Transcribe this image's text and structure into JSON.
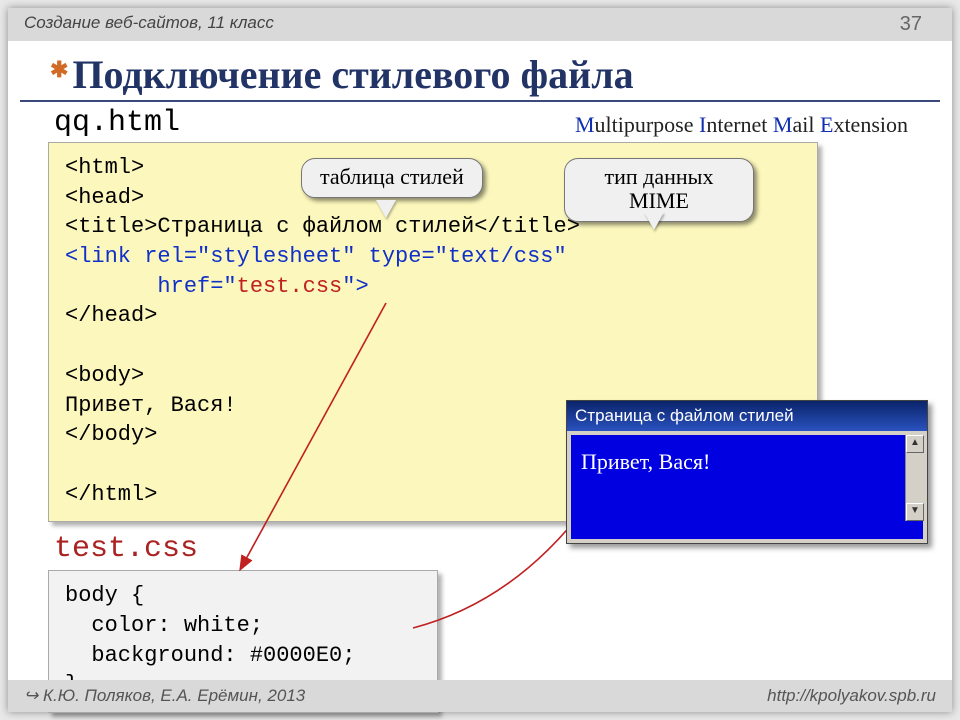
{
  "header": {
    "course": "Создание веб-сайтов, 11 класс",
    "page": "37"
  },
  "title": "Подключение стилевого файла",
  "file1": "qq.html",
  "mime": {
    "M": "M",
    "t1": "ultipurpose ",
    "I": "I",
    "t2": "nternet ",
    "Ma": "M",
    "t3": "ail ",
    "E": "E",
    "t4": "xtension"
  },
  "callouts": {
    "styleTable": "таблица стилей",
    "mimeType": "тип данных MIME"
  },
  "code": {
    "l1a": "<html>",
    "l2a": "<head>",
    "l3pre": "<title>",
    "l3mid": "Страница с файлом стилей",
    "l3post": "</title>",
    "l4a": "<link rel=\"stylesheet\" type=\"text/css\" ",
    "l4indent": "       ",
    "l4href": "href=\"",
    "l4file": "test.css",
    "l4end": "\">",
    "l5": "</head>",
    "l6": "<body>",
    "l7": "Привет, Вася!",
    "l8": "</body>",
    "l9": "</html>"
  },
  "file2": "test.css",
  "css": {
    "l1": "body { ",
    "l2": "  color: white;",
    "l3": "  background: #0000E0;",
    "l4": "}"
  },
  "browser": {
    "title": "Страница с файлом стилей",
    "body": "Привет, Вася!",
    "up": "▲",
    "down": "▼",
    "left": "◄",
    "right": "►"
  },
  "footer": {
    "authors": "↪ К.Ю. Поляков, Е.А. Ерёмин, 2013",
    "url": "http://kpolyakov.spb.ru"
  }
}
